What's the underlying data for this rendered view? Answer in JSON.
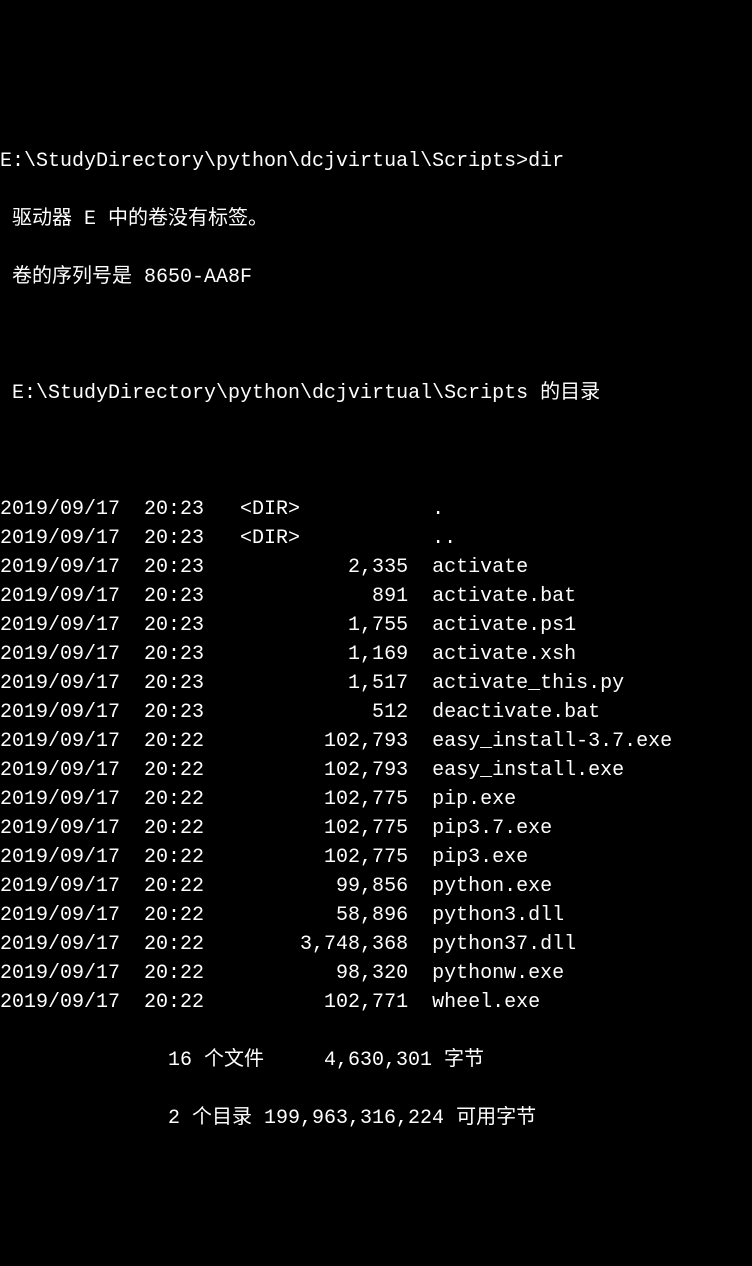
{
  "prompt": {
    "path": "E:\\StudyDirectory\\python\\dcjvirtual\\Scripts>",
    "cmd": "dir"
  },
  "header": {
    "vol_line": " 驱动器 E 中的卷没有标签。",
    "serial_line": " 卷的序列号是 8650-AA8F",
    "dir_of": " E:\\StudyDirectory\\python\\dcjvirtual\\Scripts 的目录"
  },
  "entries": [
    {
      "date": "2019/09/17",
      "time": "20:23",
      "attr": "<DIR>",
      "size": "",
      "name": "."
    },
    {
      "date": "2019/09/17",
      "time": "20:23",
      "attr": "<DIR>",
      "size": "",
      "name": ".."
    },
    {
      "date": "2019/09/17",
      "time": "20:23",
      "attr": "",
      "size": "2,335",
      "name": "activate"
    },
    {
      "date": "2019/09/17",
      "time": "20:23",
      "attr": "",
      "size": "891",
      "name": "activate.bat"
    },
    {
      "date": "2019/09/17",
      "time": "20:23",
      "attr": "",
      "size": "1,755",
      "name": "activate.ps1"
    },
    {
      "date": "2019/09/17",
      "time": "20:23",
      "attr": "",
      "size": "1,169",
      "name": "activate.xsh"
    },
    {
      "date": "2019/09/17",
      "time": "20:23",
      "attr": "",
      "size": "1,517",
      "name": "activate_this.py"
    },
    {
      "date": "2019/09/17",
      "time": "20:23",
      "attr": "",
      "size": "512",
      "name": "deactivate.bat"
    },
    {
      "date": "2019/09/17",
      "time": "20:22",
      "attr": "",
      "size": "102,793",
      "name": "easy_install-3.7.exe"
    },
    {
      "date": "2019/09/17",
      "time": "20:22",
      "attr": "",
      "size": "102,793",
      "name": "easy_install.exe"
    },
    {
      "date": "2019/09/17",
      "time": "20:22",
      "attr": "",
      "size": "102,775",
      "name": "pip.exe"
    },
    {
      "date": "2019/09/17",
      "time": "20:22",
      "attr": "",
      "size": "102,775",
      "name": "pip3.7.exe"
    },
    {
      "date": "2019/09/17",
      "time": "20:22",
      "attr": "",
      "size": "102,775",
      "name": "pip3.exe"
    },
    {
      "date": "2019/09/17",
      "time": "20:22",
      "attr": "",
      "size": "99,856",
      "name": "python.exe"
    },
    {
      "date": "2019/09/17",
      "time": "20:22",
      "attr": "",
      "size": "58,896",
      "name": "python3.dll"
    },
    {
      "date": "2019/09/17",
      "time": "20:22",
      "attr": "",
      "size": "3,748,368",
      "name": "python37.dll"
    },
    {
      "date": "2019/09/17",
      "time": "20:22",
      "attr": "",
      "size": "98,320",
      "name": "pythonw.exe"
    },
    {
      "date": "2019/09/17",
      "time": "20:22",
      "attr": "",
      "size": "102,771",
      "name": "wheel.exe"
    }
  ],
  "summary": {
    "files_count": "16",
    "files_label": "个文件",
    "files_bytes": "4,630,301",
    "bytes_label": "字节",
    "dirs_count": "2",
    "dirs_label": "个目录",
    "free_bytes": "199,963,316,224",
    "free_label": "可用字节"
  },
  "cols": {
    "date_w": 10,
    "gap1": 2,
    "time_w": 5,
    "attr_start": 20,
    "size_end": 34,
    "name_start": 36
  }
}
